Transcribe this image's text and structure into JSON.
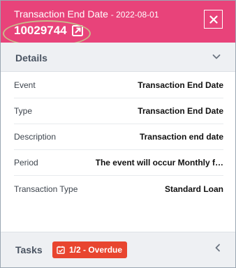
{
  "header": {
    "title": "Transaction End Date",
    "date": "- 2022-08-01",
    "id": "10029744",
    "open_icon": "external-link-icon",
    "close_icon": "close-icon"
  },
  "details": {
    "title": "Details",
    "expand_icon": "chevron-down-icon",
    "rows": [
      {
        "label": "Event",
        "value": "Transaction End Date"
      },
      {
        "label": "Type",
        "value": "Transaction End Date"
      },
      {
        "label": "Description",
        "value": "Transaction end date"
      },
      {
        "label": "Period",
        "value": "The event will occur Monthly f…"
      },
      {
        "label": "Transaction Type",
        "value": "Standard Loan"
      }
    ]
  },
  "tasks": {
    "label": "Tasks",
    "badge": "1/2 - Overdue",
    "badge_icon": "calendar-check-icon",
    "expand_icon": "chevron-left-icon"
  },
  "colors": {
    "header_bg": "#e8437a",
    "badge_bg": "#e8452f",
    "section_bg": "#eef0f3"
  }
}
